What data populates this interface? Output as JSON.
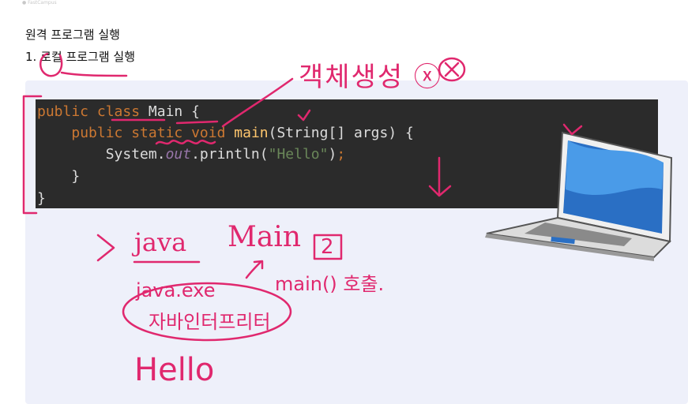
{
  "topbar": {
    "text": "● FastCampus"
  },
  "headings": {
    "title": "원격 프로그램 실행",
    "subtitle": "1. 로컬 프로그램 실행"
  },
  "code": {
    "language": "java",
    "lines": [
      "public class Main {",
      "    public static void main(String[] args) {",
      "        System.out.println(\"Hello\");",
      "    }",
      "}"
    ]
  },
  "annotations": {
    "object_note": "객체생성 ⓧ",
    "prompt": ">",
    "java_cmd": "java",
    "main_cmd": "Main",
    "step_num": "2",
    "main_call": "main() 호출.",
    "java_exe": "java.exe",
    "interpreter": "자바인터프리터",
    "output": "Hello"
  },
  "colors": {
    "ink": "#e0286e",
    "code_bg": "#2b2b2b",
    "slide_bg": "#eef0fa",
    "keyword": "#cc7832",
    "method": "#ffc66d",
    "field": "#9876aa",
    "string": "#6a8759"
  },
  "icons": {
    "laptop": "laptop-icon"
  }
}
